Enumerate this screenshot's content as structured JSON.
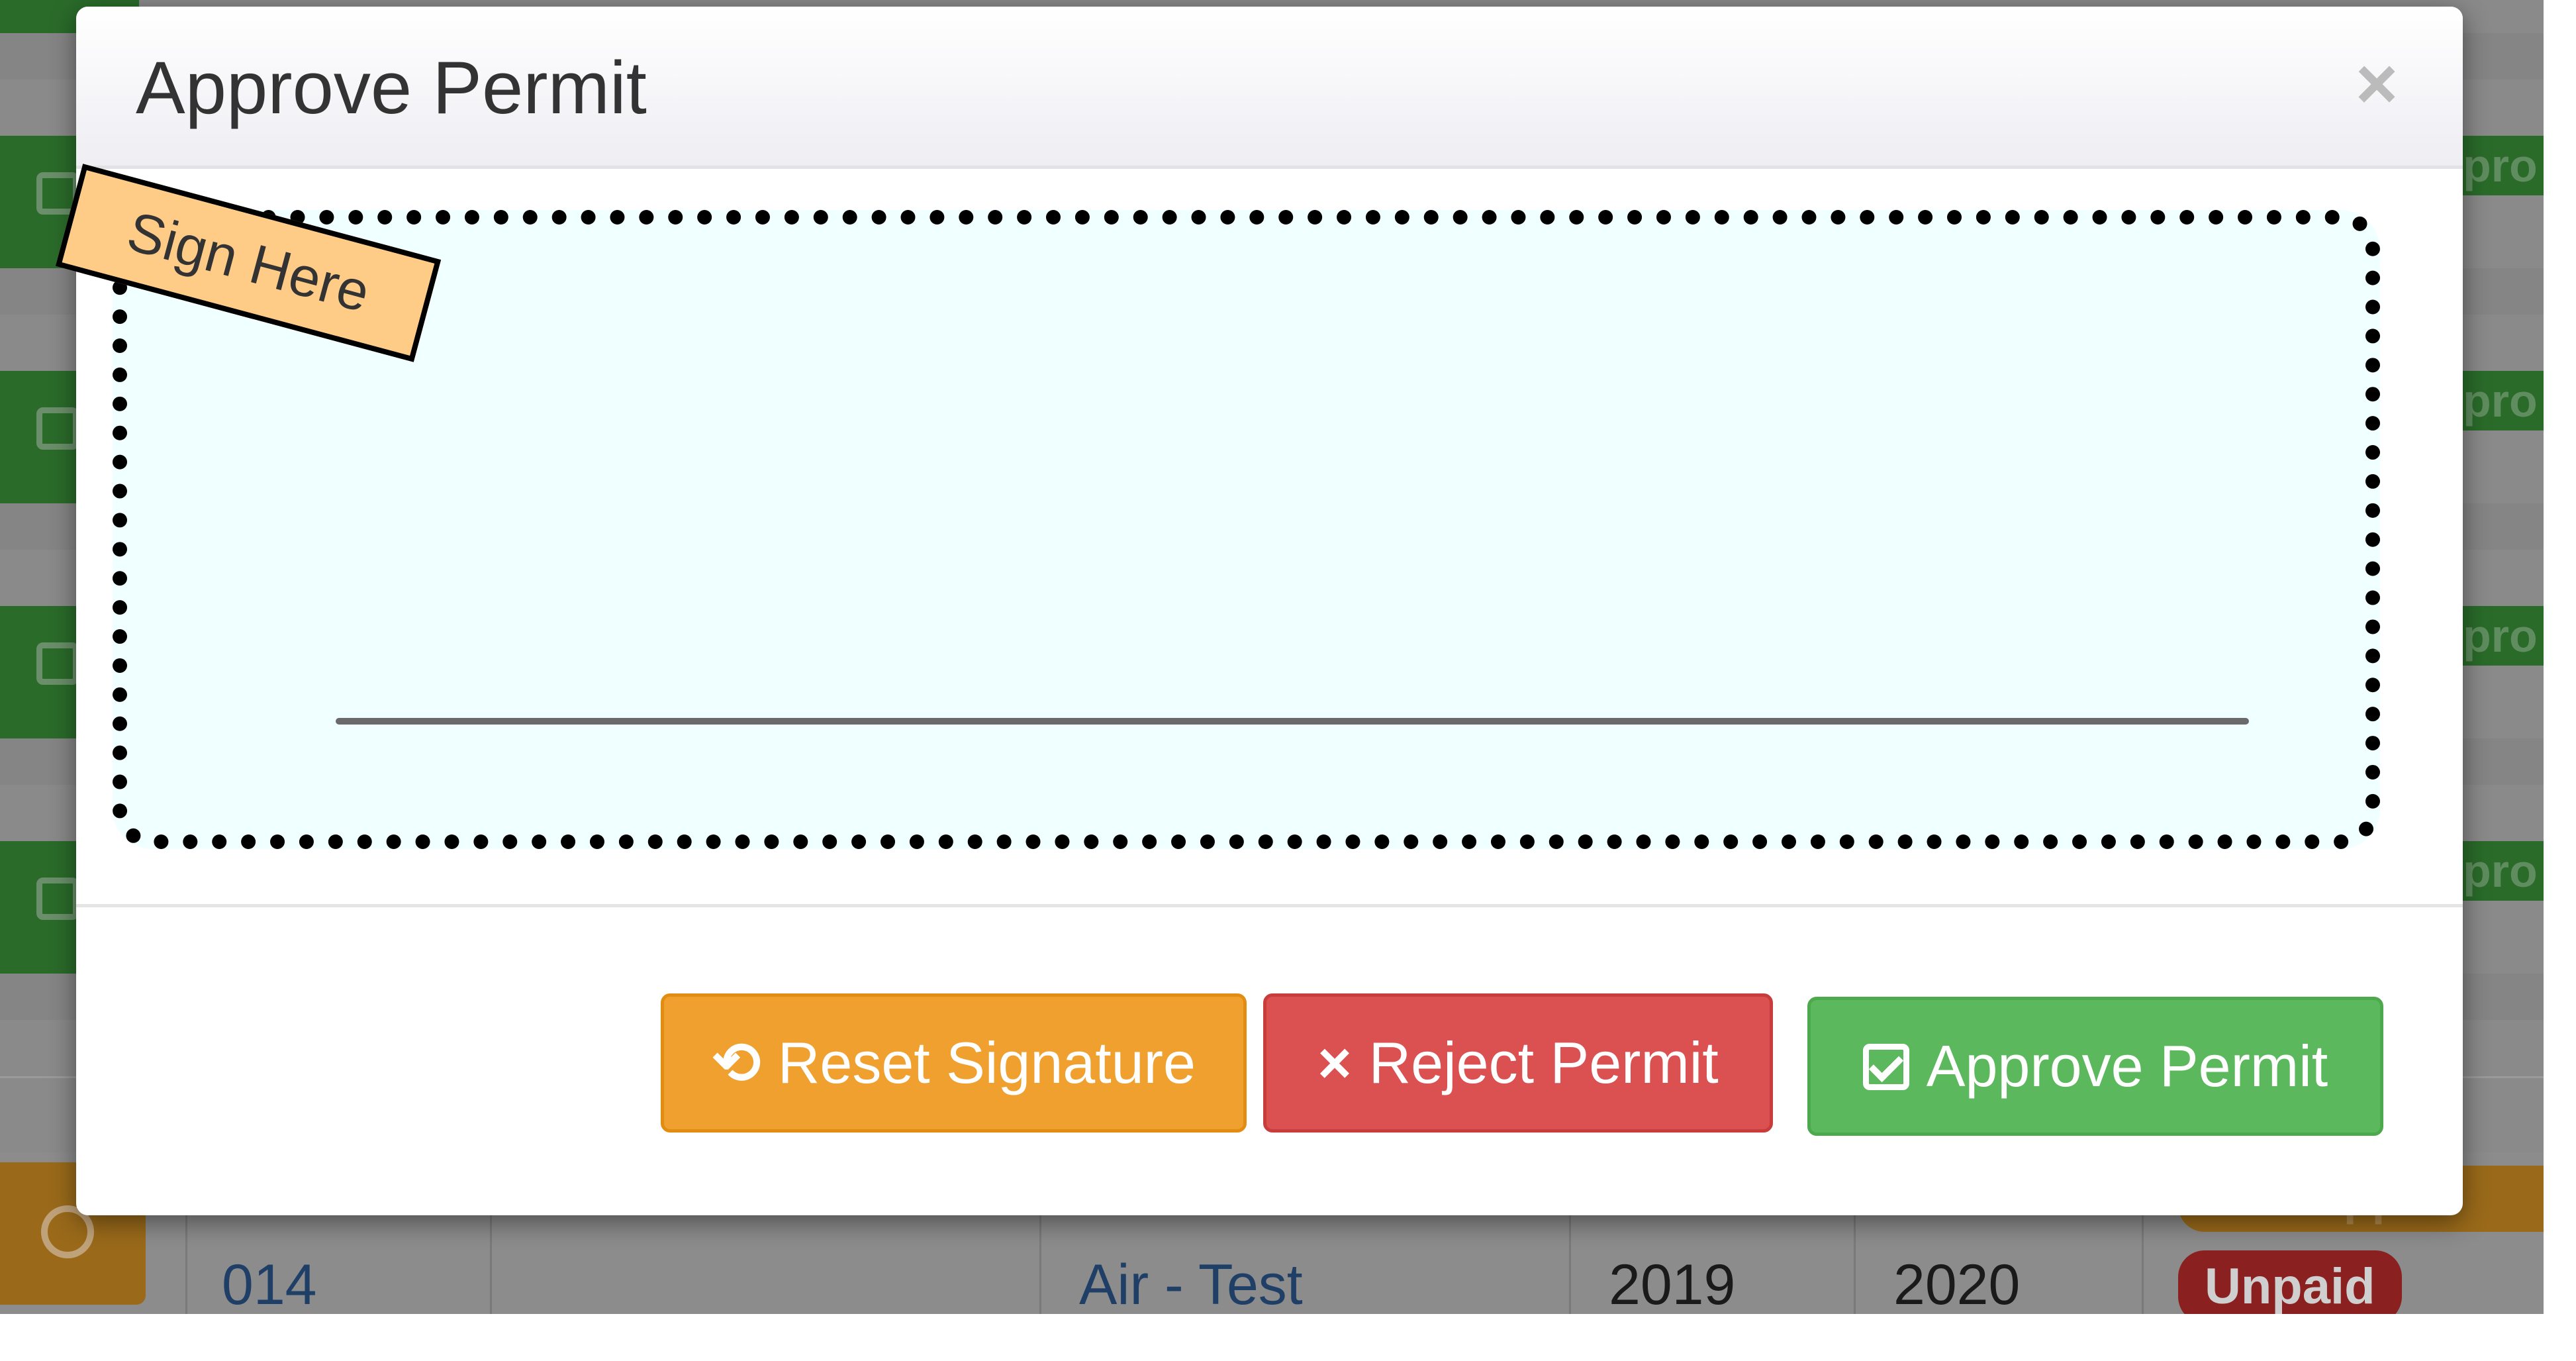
{
  "modal": {
    "title": "Approve Permit",
    "close_label": "×",
    "sign_here_label": "Sign Here",
    "buttons": {
      "reset": {
        "icon": "undo-icon",
        "icon_glyph": "⟲",
        "label": "Reset Signature",
        "color": "#f0a02e"
      },
      "reject": {
        "icon": "times-icon",
        "icon_glyph": "×",
        "label": "Reject Permit",
        "color": "#db5050"
      },
      "approve": {
        "icon": "check-square-icon",
        "label": "Approve Permit",
        "color": "#5cb85c"
      }
    }
  },
  "background": {
    "row_status_fragment": "pro",
    "bottom_row": {
      "id": "014",
      "type": "Air - Test",
      "start_year": "2019",
      "end_year": "2020",
      "payment_status": "Unpaid",
      "approval_fragment": "ppro"
    }
  },
  "colors": {
    "signature_pad_bg": "#f0ffff",
    "sign_here_bg": "#ffcc88"
  }
}
